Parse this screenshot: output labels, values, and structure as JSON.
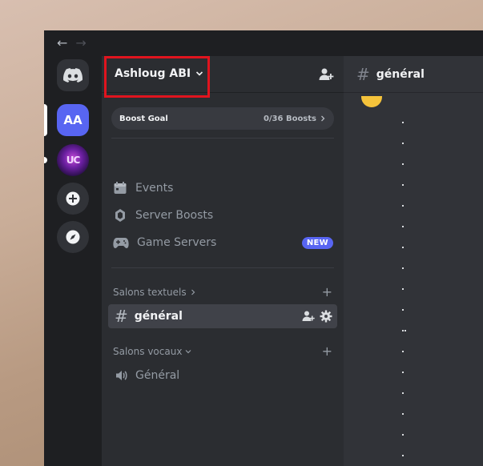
{
  "titlebar": {
    "back": "←",
    "forward": "→"
  },
  "rail": {
    "servers": [
      {
        "label": "AA"
      },
      {
        "label": "UC"
      }
    ]
  },
  "server": {
    "name": "Ashloug ABI",
    "boost_goal": {
      "label": "Boost Goal",
      "count": "0/36 Boosts"
    }
  },
  "menu": {
    "events": "Events",
    "server_boosts": "Server Boosts",
    "game_servers": "Game Servers",
    "new_badge": "NEW"
  },
  "categories": {
    "text": {
      "label": "Salons textuels",
      "add": "+"
    },
    "voice": {
      "label": "Salons vocaux",
      "add": "+"
    }
  },
  "channels": {
    "text": [
      {
        "hash": "#",
        "name": "général"
      }
    ],
    "voice": [
      {
        "name": "Général"
      }
    ]
  },
  "main": {
    "hash": "#",
    "channel_name": "général"
  },
  "colors": {
    "accent": "#5865f2",
    "highlight": "#e0141e",
    "sidebar": "#2b2d31",
    "main": "#313338",
    "rail": "#1e1f22"
  }
}
